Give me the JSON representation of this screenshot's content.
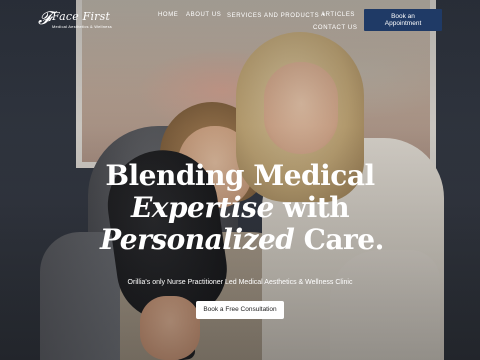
{
  "logo": {
    "mark": "𝓕",
    "title": "Face First",
    "subtitle": "Medical Aesthetics & Wellness"
  },
  "nav": {
    "items": [
      {
        "label": "HOME"
      },
      {
        "label": "ABOUT US"
      },
      {
        "label": "SERVICES AND PRODUCTS",
        "caret": "▾"
      },
      {
        "label": "ARTICLES"
      },
      {
        "label": "CONTACT US"
      }
    ],
    "book_button": {
      "line1": "Book an",
      "line2": "Appointment"
    }
  },
  "hero": {
    "headline": {
      "line1": "Blending Medical",
      "line2_em": "Expertise",
      "line2_rest": " with",
      "line3_em": "Personalized",
      "line3_rest": " Care."
    },
    "tagline": "Orillia's only Nurse Practitioner Led Medical Aesthetics & Wellness Clinic",
    "cta": "Book a Free Consultation"
  },
  "colors": {
    "accent_button": "#1f3a66",
    "text": "#ffffff"
  }
}
